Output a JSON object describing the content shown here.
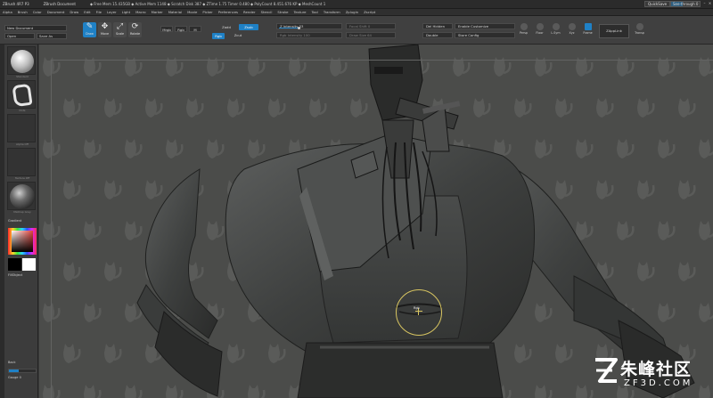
{
  "titlebar": {
    "app": "ZBrush 4R7 P3",
    "document": "ZBrush Document",
    "stats": "◆ Free Mem 15.435GB ◆ Active Mem 1148 ◆ Scratch Disk 387 ◆ ZTime 1.75 Timer 0.480 ◆ PolyCount 8.451.676 KP ◆ MeshCount 1",
    "quicksave": "QuickSave",
    "seethrough_label": "See-through 0",
    "seethrough_level": 0.4
  },
  "menubar": {
    "items": [
      "Alpha",
      "Brush",
      "Color",
      "Document",
      "Draw",
      "Edit",
      "File",
      "Layer",
      "Light",
      "Macro",
      "Marker",
      "Material",
      "Movie",
      "Picker",
      "Preferences",
      "Render",
      "Stencil",
      "Stroke",
      "Texture",
      "Tool",
      "Transform",
      "Zplugin",
      "Zscript"
    ]
  },
  "shelf": {
    "new_document": "New Document",
    "open": "Open",
    "save_as": "Save As",
    "tools": [
      {
        "label": "Draw",
        "icon": "draw-icon",
        "active": true
      },
      {
        "label": "Move",
        "icon": "move-icon",
        "active": false
      },
      {
        "label": "Scale",
        "icon": "scale-icon",
        "active": false
      },
      {
        "label": "Rotate",
        "icon": "rotate-icon",
        "active": false
      }
    ],
    "mrgb": "Mrgb",
    "rgb": "Rgb",
    "m": "M",
    "zadd": "Zadd",
    "zsub": "Zsub",
    "zcut": "Zcut",
    "focal_shift": "Focal Shift 0",
    "z_intensity": "Z Intensity 33",
    "z_intensity_value": 33,
    "rgb_intensity": "Rgb Intensity 100",
    "draw_size": "Draw Size 64",
    "dynamic": "Dynamic",
    "del_hidden": "Del Hidden",
    "enable_customize": "Enable Customize",
    "double": "Double",
    "store_config": "Store Config",
    "right_icons": [
      {
        "label": "Persp",
        "icon": "persp-icon"
      },
      {
        "label": "Floor",
        "icon": "floor-icon"
      },
      {
        "label": "L.Sym",
        "icon": "lsym-icon"
      },
      {
        "label": "Xyz",
        "icon": "xyz-icon"
      },
      {
        "label": "Frame",
        "icon": "frame-icon"
      },
      {
        "label": "Transp",
        "icon": "transp-icon"
      }
    ],
    "zapplink": "ZAppLink"
  },
  "left_panel": {
    "brush_caption": "Standard",
    "stroke_caption": "Dots",
    "alpha_caption": "Alpha Off",
    "texture_caption": "Texture Off",
    "material_caption": "MatCap Gray",
    "gradient_label": "Gradient",
    "switch_color_label": "SwitchColor",
    "alternate_label": "Alternate",
    "fill_object": "FillObject",
    "back_label": "Back",
    "gauge_label": "Gauge 0",
    "gauge_level": 0.35,
    "main_color": "#ffffff",
    "secondary_color": "#000000"
  },
  "canvas": {
    "brush_tip": "Rgb",
    "background_color": "#4b4c4a",
    "accent_color": "#1f81c6",
    "cursor_color": "#d8c561"
  },
  "watermark": {
    "cn": "朱峰社区",
    "en": "ZF3D.COM"
  }
}
